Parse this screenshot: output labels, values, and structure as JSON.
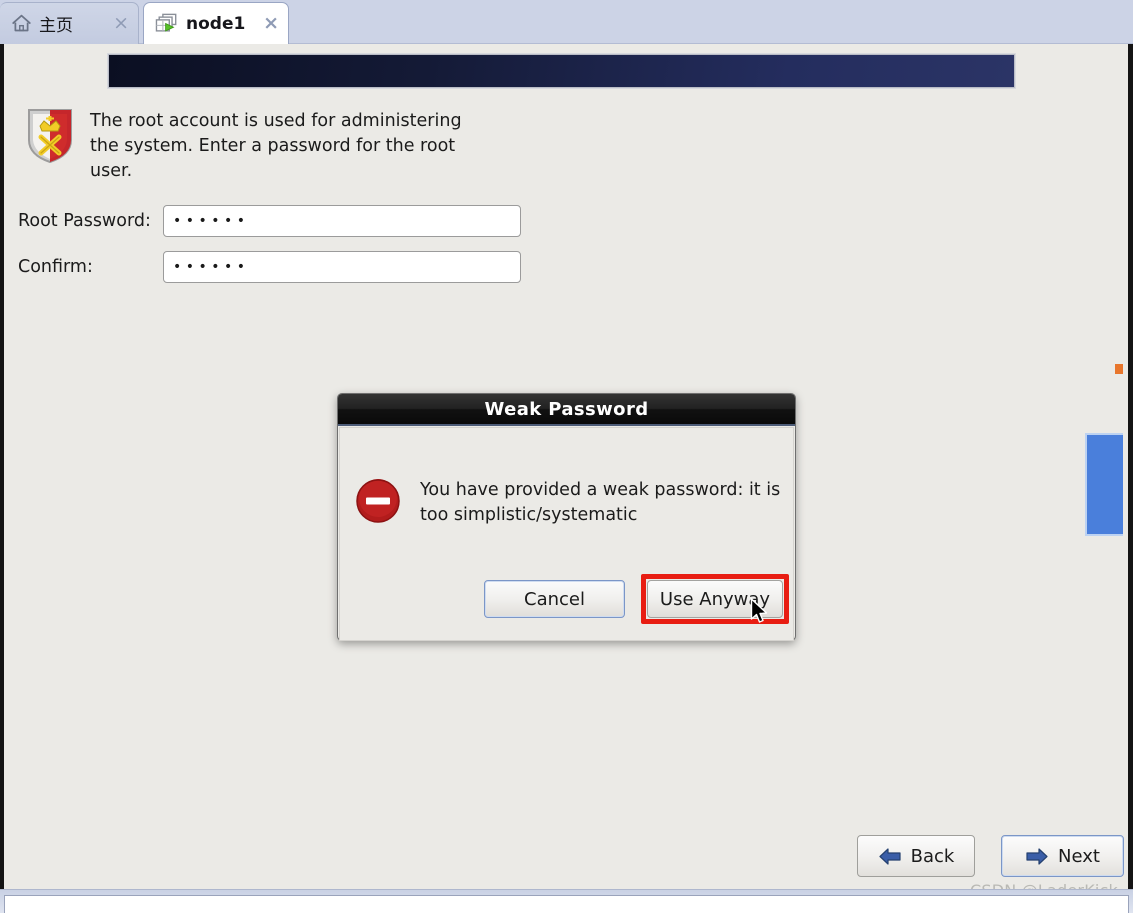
{
  "tabs": [
    {
      "id": "home",
      "label": "主页",
      "icon": "home-icon",
      "close": "×",
      "active": false
    },
    {
      "id": "node1",
      "label": "node1",
      "icon": "vm-screen-icon",
      "close": "×",
      "active": true
    }
  ],
  "installer": {
    "root_info_text": "The root account is used for administering the system.  Enter a password for the root user.",
    "root_icon": "root-shield-icon",
    "fields": [
      {
        "label": "Root Password:",
        "value": "••••••",
        "masked": true
      },
      {
        "label": "Confirm:",
        "value": "••••••",
        "masked": true
      }
    ],
    "nav": {
      "back_label": "Back",
      "back_icon": "arrow-left-icon",
      "next_label": "Next",
      "next_icon": "arrow-right-icon"
    }
  },
  "dialog": {
    "title": "Weak Password",
    "icon": "error-circle-icon",
    "message": "You have provided a weak password: it is too simplistic/systematic",
    "buttons": [
      {
        "id": "cancel",
        "label": "Cancel",
        "focused": true
      },
      {
        "id": "use-anyway",
        "label": "Use Anyway",
        "highlighted": true
      }
    ]
  },
  "watermark": "CSDN @LaderKick",
  "colors": {
    "tabbar_bg": "#ccd3e6",
    "installer_bg": "#ebeae6",
    "banner_start": "#0b0f22",
    "banner_end": "#2b3466",
    "dialog_titlebar": "#111111",
    "error_red": "#b21c1c",
    "highlight_red": "#e81d12",
    "focus_blue": "#7b96c7",
    "edge_blue": "#4a7fdb",
    "edge_orange": "#e8762c"
  }
}
